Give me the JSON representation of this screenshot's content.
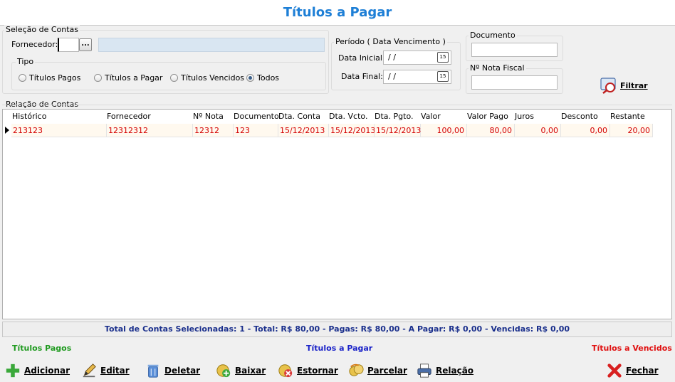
{
  "window": {
    "title": "Títulos a Pagar"
  },
  "selecao": {
    "label": "Seleção de Contas",
    "fornecedor_label": "Fornecedor:",
    "fornecedor_code": "",
    "fornecedor_name": "",
    "lookup_label": "...",
    "tipo": {
      "label": "Tipo",
      "options": [
        "Títulos Pagos",
        "Títulos a Pagar",
        "Títulos Vencidos",
        "Todos"
      ],
      "selected": "Todos"
    }
  },
  "periodo": {
    "label": "Período ( Data Vencimento )",
    "inicial_label": "Data Inicial:",
    "inicial_value": " / /",
    "final_label": "Data Final:",
    "final_value": " / /",
    "calendar_label": "15"
  },
  "documento": {
    "label": "Documento",
    "value": ""
  },
  "nota_fiscal": {
    "label": "Nº Nota Fiscal",
    "value": ""
  },
  "filtrar_label": "Filtrar",
  "relacao": {
    "label": "Relação de Contas",
    "columns": [
      "Histórico",
      "Fornecedor",
      "Nº Nota",
      "Documento",
      "Dta. Conta",
      "Dta. Vcto.",
      "Dta. Pgto.",
      "Valor",
      "Valor Pago",
      "Juros",
      "Desconto",
      "Restante"
    ],
    "rows": [
      [
        "213123",
        "12312312",
        "12312",
        "123",
        "15/12/2013",
        "15/12/2013",
        "15/12/2013",
        "100,00",
        "80,00",
        "0,00",
        "0,00",
        "20,00"
      ]
    ],
    "row_color": "#d40000"
  },
  "totals": "Total de Contas Selecionadas: 1 - Total: R$ 80,00 - Pagas: R$ 80,00 - A Pagar: R$ 0,00 - Vencidas: R$ 0,00",
  "legend": {
    "pagos": "Títulos Pagos",
    "a_pagar": "Títulos a Pagar",
    "vencidos": "Títulos a Vencidos",
    "colors": {
      "pagos": "#1f9a1f",
      "a_pagar": "#1a22c8",
      "vencidos": "#e01010"
    }
  },
  "toolbar": {
    "adicionar": "Adicionar",
    "editar": "Editar",
    "deletar": "Deletar",
    "baixar": "Baixar",
    "estornar": "Estornar",
    "parcelar": "Parcelar",
    "relacao": "Relação",
    "fechar": "Fechar"
  }
}
